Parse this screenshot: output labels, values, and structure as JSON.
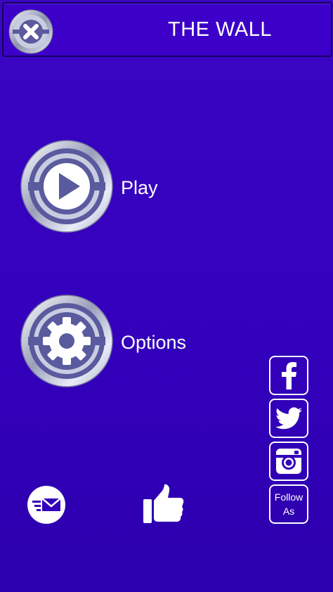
{
  "header": {
    "title": "THE WALL",
    "close_icon": "close-icon"
  },
  "menu": {
    "play": {
      "label": "Play",
      "icon": "play-icon"
    },
    "options": {
      "label": "Options",
      "icon": "gear-icon"
    }
  },
  "social": {
    "facebook_icon": "facebook-icon",
    "twitter_icon": "twitter-icon",
    "instagram_icon": "instagram-icon",
    "follow_line1": "Follow",
    "follow_line2": "As"
  },
  "bottom": {
    "mail_icon": "mail-icon",
    "like_icon": "thumbs-up-icon"
  },
  "colors": {
    "background": "#3300bb",
    "header": "#3c00c8",
    "button_inner": "#5a5a9e",
    "silver": "#c8cde0",
    "text": "#ffffff"
  }
}
